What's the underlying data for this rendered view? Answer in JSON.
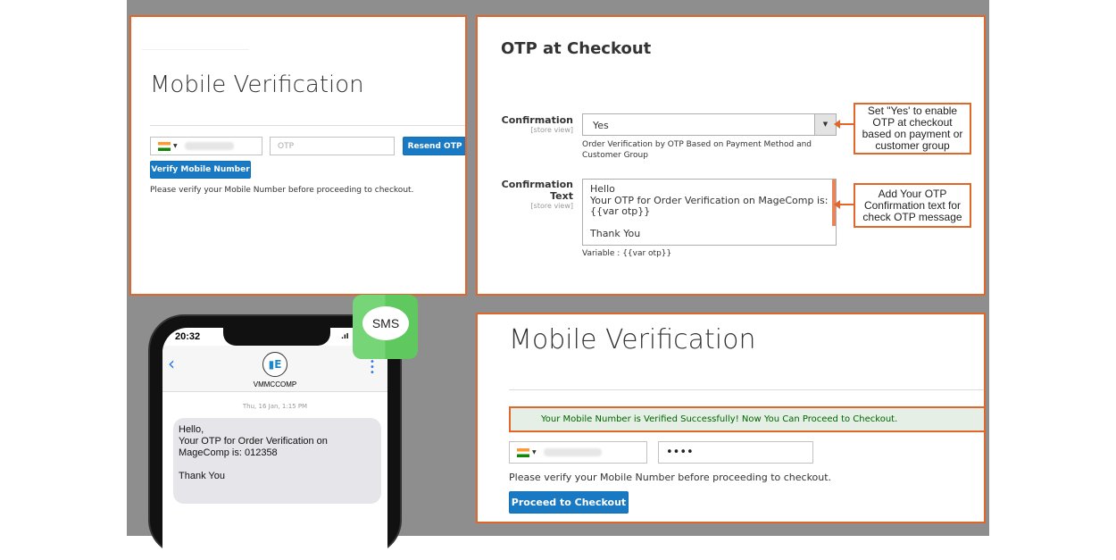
{
  "panel1": {
    "title": "Mobile Verification",
    "otp_placeholder": "OTP",
    "resend_label": "Resend OTP",
    "verify_label": "Verify Mobile Number",
    "note": "Please verify your Mobile Number before proceeding to checkout."
  },
  "panel2": {
    "title": "OTP at Checkout",
    "confirmation": {
      "label": "Confirmation",
      "scope": "[store view]",
      "value": "Yes",
      "hint": "Order Verification by OTP Based on Payment Method and Customer Group"
    },
    "confirmation_text": {
      "label": "Confirmation Text",
      "scope": "[store view]",
      "lines": [
        "Hello",
        "Your OTP for Order Verification on MageComp is:",
        "{{var otp}}",
        "",
        "Thank You"
      ],
      "variable": "Variable : {{var otp}}"
    },
    "callout1": "Set \"Yes' to enable OTP at checkout based on payment or customer group",
    "callout2": "Add Your OTP Confirmation text for check OTP message"
  },
  "phone": {
    "time": "20:32",
    "sender": "VMMCCOMP",
    "timestamp": "Thu, 16 Jan, 1:15 PM",
    "message_lines": [
      "Hello,",
      "Your OTP for Order Verification on MageComp is: 012358",
      "",
      "Thank You"
    ],
    "badge": "SMS"
  },
  "panel3": {
    "title": "Mobile Verification",
    "success": "Your Mobile Number is Verified Successfully! Now You Can Proceed to Checkout.",
    "otp_value": "••••",
    "note": "Please verify your Mobile Number before proceeding to checkout.",
    "proceed_label": "Proceed to Checkout"
  },
  "colors": {
    "accent": "#e0662a",
    "button": "#1979c3",
    "success_text": "#006400",
    "sms_green": "#6fcf6f"
  }
}
